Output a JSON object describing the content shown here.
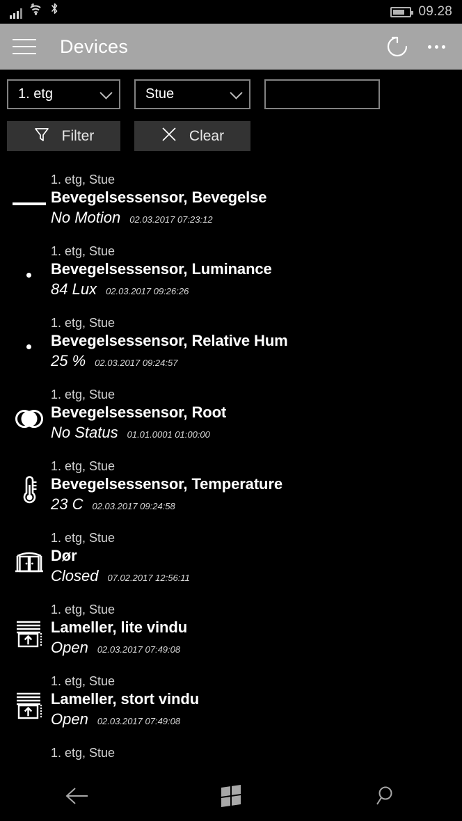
{
  "status_bar": {
    "signal_icon": "cellular-signal-icon",
    "signal_bars_filled": 3,
    "wifi_icon": "wifi-icon",
    "bluetooth_icon": "bluetooth-icon",
    "battery_icon": "battery-icon",
    "battery_level_percent": 70,
    "time": "09.28"
  },
  "app_bar": {
    "menu_icon": "hamburger-menu-icon",
    "title": "Devices",
    "refresh_icon": "refresh-icon",
    "more_icon": "more-options-icon"
  },
  "filters": {
    "floor_select": {
      "value": "1. etg",
      "chevron_icon": "chevron-down-icon"
    },
    "room_select": {
      "value": "Stue",
      "chevron_icon": "chevron-down-icon"
    },
    "search_input": {
      "value": "",
      "placeholder": ""
    },
    "filter_button": {
      "label": "Filter",
      "icon": "funnel-icon"
    },
    "clear_button": {
      "label": "Clear",
      "icon": "close-x-icon"
    }
  },
  "devices": [
    {
      "location": "1. etg, Stue",
      "name": "Bevegelsessensor, Bevegelse",
      "state": "No Motion",
      "timestamp": "02.03.2017 07:23:12",
      "icon": "horizontal-line-icon"
    },
    {
      "location": "1. etg, Stue",
      "name": "Bevegelsessensor, Luminance",
      "state": "84 Lux",
      "timestamp": "02.03.2017 09:26:26",
      "icon": "dot-icon"
    },
    {
      "location": "1. etg, Stue",
      "name": "Bevegelsessensor, Relative Hum",
      "state": "25 %",
      "timestamp": "02.03.2017 09:24:57",
      "icon": "dot-icon"
    },
    {
      "location": "1. etg, Stue",
      "name": "Bevegelsessensor, Root",
      "state": "No Status",
      "timestamp": "01.01.0001 01:00:00",
      "icon": "overlapping-circles-icon"
    },
    {
      "location": "1. etg, Stue",
      "name": "Bevegelsessensor, Temperature",
      "state": "23 C",
      "timestamp": "02.03.2017 09:24:58",
      "icon": "thermometer-icon"
    },
    {
      "location": "1. etg, Stue",
      "name": "Dør",
      "state": "Closed",
      "timestamp": "07.02.2017 12:56:11",
      "icon": "double-door-icon"
    },
    {
      "location": "1. etg, Stue",
      "name": "Lameller, lite vindu",
      "state": "Open",
      "timestamp": "02.03.2017 07:49:08",
      "icon": "blinds-icon"
    },
    {
      "location": "1. etg, Stue",
      "name": "Lameller, stort vindu",
      "state": "Open",
      "timestamp": "02.03.2017 07:49:08",
      "icon": "blinds-icon"
    },
    {
      "location": "1. etg, Stue",
      "name": "",
      "state": "",
      "timestamp": "",
      "icon": "none"
    }
  ],
  "nav_bar": {
    "back_icon": "back-arrow-icon",
    "start_icon": "windows-start-icon",
    "search_icon": "search-icon"
  },
  "colors": {
    "background": "#000000",
    "app_bar": "#a6a6a6",
    "button": "#333333",
    "border": "#828282",
    "text_primary": "#ffffff",
    "text_secondary": "#d2d2d2"
  }
}
